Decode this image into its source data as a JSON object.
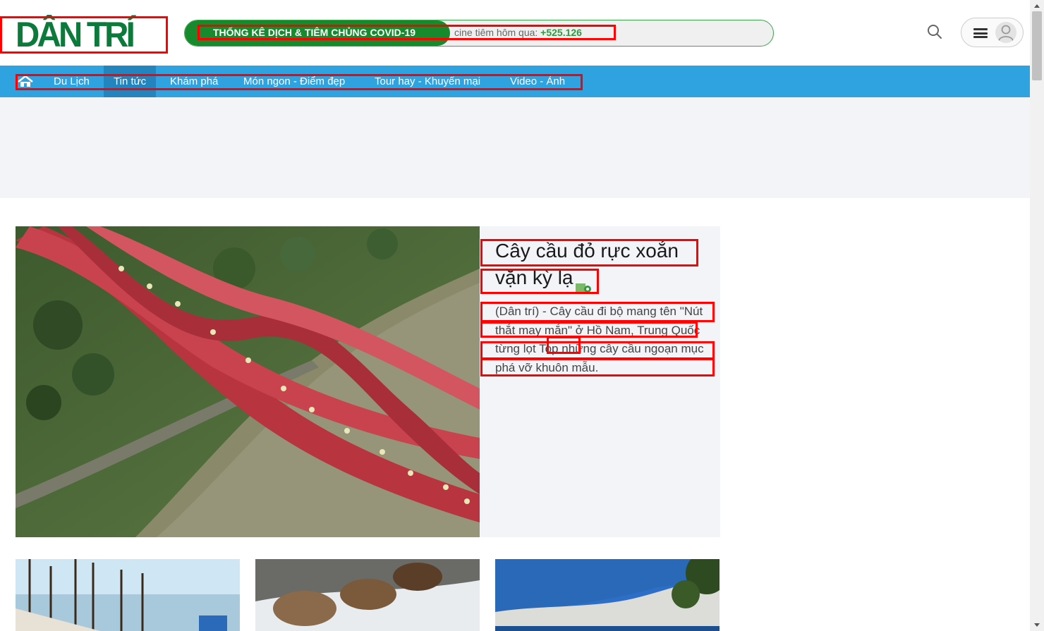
{
  "header": {
    "logo_text": "DÂN TRÍ",
    "ticker_tag": "THỐNG KÊ DỊCH & TIÊM CHỦNG COVID-19",
    "ticker_text_prefix": "cine tiêm hôm qua: ",
    "ticker_number": "+525.126",
    "search_icon": "search-icon",
    "menu_icon": "hamburger-icon",
    "avatar_icon": "user-avatar-icon"
  },
  "nav": {
    "home_icon": "home-icon",
    "items": [
      {
        "label": "Du Lịch"
      },
      {
        "label": "Tin tức"
      },
      {
        "label": "Khám phá"
      },
      {
        "label": "Món ngon - Điểm đẹp"
      },
      {
        "label": "Tour hay - Khuyến mại"
      },
      {
        "label": "Video - Ảnh"
      }
    ],
    "active_index": 1
  },
  "featured": {
    "title": "Cây cầu đỏ rực xoắn vặn kỳ lạ",
    "title_badge_icon": "photo-gallery-icon",
    "description": "(Dân trí) - Cây cầu đi bộ mang tên \"Nút thắt may mắn\" ở Hồ Nam, Trung Quốc từng lọt Top những cây cầu ngoạn mục phá vỡ khuôn mẫu.",
    "image": "red-twisted-bridge-aerial-photo"
  },
  "thumbs": [
    {
      "image": "ship-masts-photo"
    },
    {
      "image": "bears-in-river-photo"
    },
    {
      "image": "coastal-landscape-photo"
    }
  ],
  "colors": {
    "brand_green": "#0b7a3a",
    "nav_blue": "#2ea3e0",
    "nav_active": "#2484bd",
    "ticker_green": "#168a2c",
    "annotation_red": "#ff0000"
  }
}
